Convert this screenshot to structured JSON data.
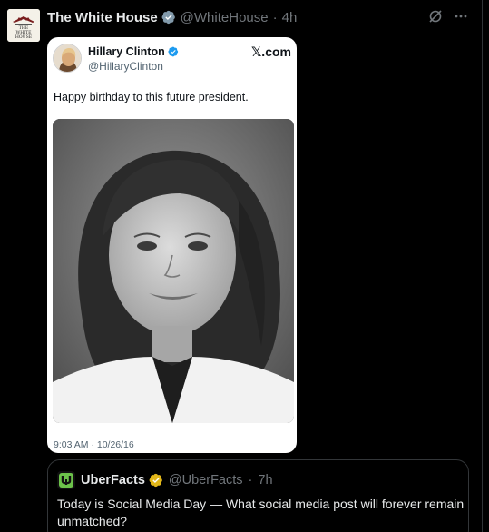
{
  "post": {
    "author_name": "The White House",
    "author_handle": "@WhiteHouse",
    "separator": "·",
    "time": "4h",
    "avatar_text": [
      "THE",
      "WHITE",
      "HOUSE"
    ],
    "actions": [
      {
        "icon": "grok-icon"
      },
      {
        "icon": "more-icon"
      }
    ]
  },
  "embedded_tweet": {
    "author_name": "Hillary Clinton",
    "author_handle": "@HillaryClinton",
    "source": "𝕏.com",
    "text": "Happy birthday to this future president.",
    "timestamp": "9:03 AM · 10/26/16"
  },
  "quote": {
    "author_name": "UberFacts",
    "author_handle": "@UberFacts",
    "separator": "·",
    "time": "7h",
    "text": "Today is Social Media Day — What social media post will forever remain unmatched?"
  },
  "colors": {
    "background": "#000000",
    "verified_gray": "#829aab",
    "verified_blue": "#1d9bf0",
    "verified_gold": "#e2b719",
    "muted_text": "#71767b"
  }
}
